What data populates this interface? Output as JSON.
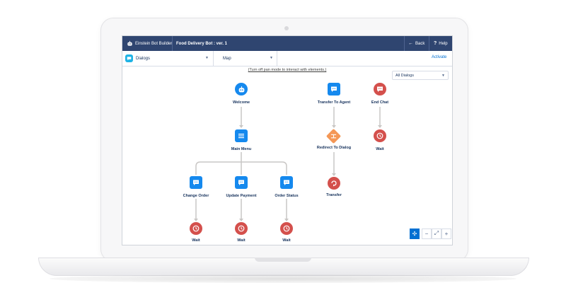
{
  "topbar": {
    "app_name": "Einstein Bot Builder",
    "bot_title": "Food Delivery Bot : ver. 1",
    "back_label": "Back",
    "help_label": "Help"
  },
  "subbar": {
    "dialogs_label": "Dialogs",
    "view_label": "Map",
    "activate_label": "Activate"
  },
  "canvas": {
    "pan_hint": "(Turn off pan mode to interact with elements.)",
    "filter_label": "All Dialogs",
    "nodes": {
      "welcome": "Welcome",
      "main_menu": "Main Menu",
      "change_order": "Change Order",
      "update_payment": "Update Payment",
      "order_status": "Order Status",
      "wait1": "Wait",
      "wait2": "Wait",
      "wait3": "Wait",
      "transfer_to_agent": "Transfer To Agent",
      "redirect_to_dialog": "Redirect To Dialog",
      "transfer": "Transfer",
      "end_chat": "End Chat",
      "wait4": "Wait"
    }
  },
  "colors": {
    "header_bg": "#2f4570",
    "dialog_blue": "#1589ee",
    "wait_red": "#d4504c",
    "redirect_orange": "#f49756",
    "link_blue": "#0070d2"
  },
  "zoom": {
    "pan": "✣",
    "zoom_out": "−",
    "fit": "⤢",
    "zoom_in": "+"
  }
}
